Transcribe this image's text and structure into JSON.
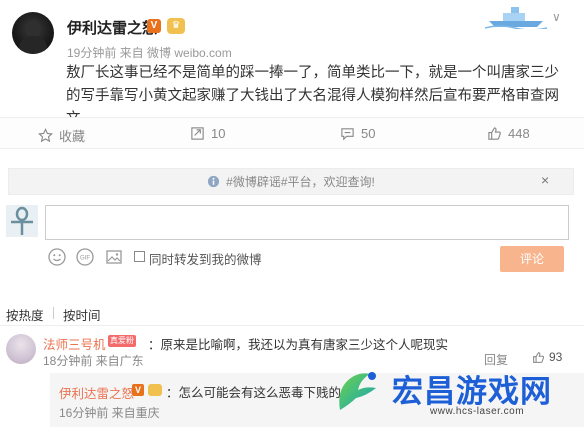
{
  "post": {
    "author": "伊利达雷之怒",
    "v_badge": "V",
    "meta": "19分钟前 来自 微博 weibo.com",
    "collapse": "∨",
    "content": "敖厂长这事已经不是简单的踩一捧一了，简单类比一下，就是一个叫唐家三少的写手靠写小黄文起家赚了大钱出了大名混得人模狗样然后宣布要严格审查网文。"
  },
  "actions": {
    "favorite": "收藏",
    "repost": "10",
    "comment": "50",
    "like": "448"
  },
  "comment_box": {
    "notice": "#微博辟谣#平台，欢迎查询!",
    "close": "×",
    "forward_label": "同时转发到我的微博",
    "submit": "评论"
  },
  "sort": {
    "hot": "按热度",
    "time": "按时间"
  },
  "comments": [
    {
      "name": "法师三号机",
      "badge": "真爱粉",
      "text": "：原来是比喻啊，我还以为真有唐家三少这个人呢现实",
      "meta": "18分钟前 来自广东",
      "report": "回复",
      "likes": "93"
    }
  ],
  "reply": {
    "name": "伊利达雷之怒",
    "v_badge": "V",
    "text": "：怎么可能会有这么恶毒下贱的",
    "meta": "16分钟前 来自重庆"
  },
  "watermark": {
    "title": "宏昌游戏网",
    "url": "www.hcs-laser.com"
  },
  "colors": {
    "accent": "#eb7350",
    "submit_bg": "#f7b48d",
    "watermark_blue": "#1d5fd6",
    "v_badge": "#e8711b"
  }
}
